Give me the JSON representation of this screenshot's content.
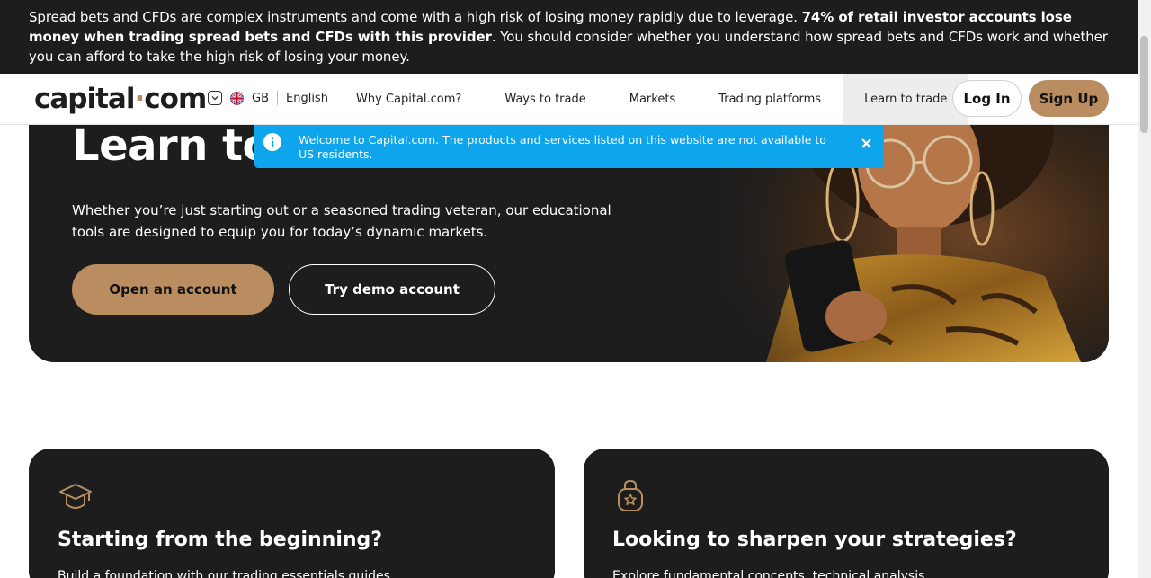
{
  "risk_banner": {
    "text_plain": "Spread bets and CFDs are complex instruments and come with a high risk of losing money rapidly due to leverage. ",
    "text_bold": "74% of retail investor accounts lose money when trading spread bets and CFDs with this provider",
    "text_tail": ". You should consider whether you understand how spread bets and CFDs work and whether you can afford to take the high risk of losing your money."
  },
  "header": {
    "logo_main": "capital",
    "logo_dot": "·",
    "logo_tld": "com",
    "region": "GB",
    "language": "English",
    "nav": [
      {
        "label": "Why Capital.com?"
      },
      {
        "label": "Ways to trade"
      },
      {
        "label": "Markets"
      },
      {
        "label": "Trading platforms"
      },
      {
        "label": "Learn to trade",
        "active": true
      }
    ],
    "login_label": "Log In",
    "signup_label": "Sign Up"
  },
  "notice": {
    "text": "Welcome to Capital.com. The products and services listed on this website are not available to US residents."
  },
  "hero": {
    "title": "Learn to trade",
    "subtitle": "Whether you’re just starting out or a seasoned trading veteran, our educational tools are designed to equip you for today’s dynamic markets.",
    "open_account_label": "Open an account",
    "demo_label": "Try demo account"
  },
  "cards": [
    {
      "icon": "graduation-cap-icon",
      "title": "Starting from the beginning?",
      "line": "Build a foundation with our trading essentials guides"
    },
    {
      "icon": "lock-star-icon",
      "title": "Looking to sharpen your strategies?",
      "line": "Explore fundamental concepts, technical analysis"
    }
  ],
  "colors": {
    "brand_dark": "#1d1d1d",
    "accent": "#b98d5f",
    "notice_blue": "#0ea5ec"
  }
}
